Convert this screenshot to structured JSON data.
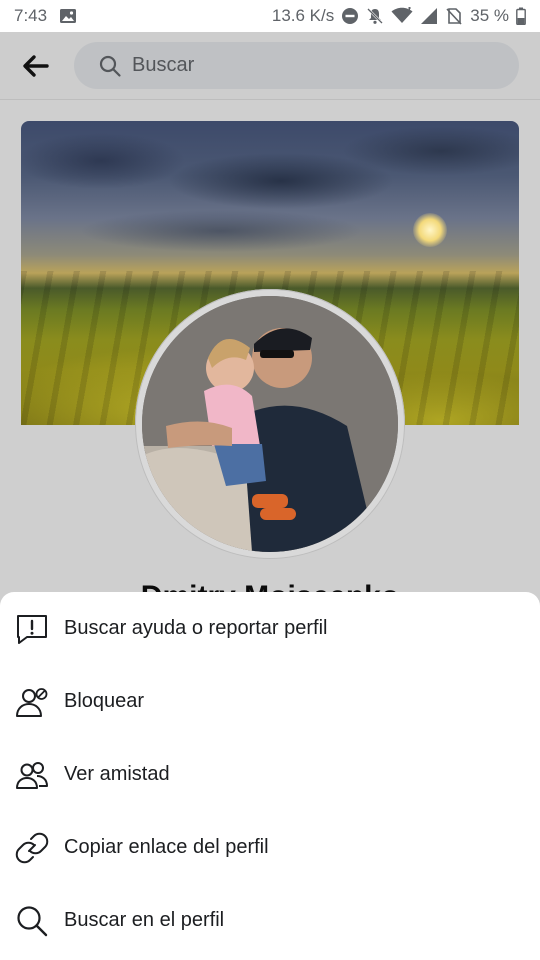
{
  "status_bar": {
    "time": "7:43",
    "network_speed": "13.6 K/s",
    "battery": "35 %",
    "icons": [
      "image-notification-icon",
      "data-saver-icon",
      "mute-icon",
      "wifi-icon",
      "signal-icon",
      "no-sim-icon",
      "battery-icon"
    ]
  },
  "header": {
    "back_icon": "arrow-left-icon",
    "search_placeholder": "Buscar"
  },
  "profile": {
    "name": "Dmitry Moiseenko"
  },
  "sheet": {
    "items": [
      {
        "label": "Buscar ayuda o reportar perfil",
        "icon": "report-icon"
      },
      {
        "label": "Bloquear",
        "icon": "block-user-icon"
      },
      {
        "label": "Ver amistad",
        "icon": "friends-icon"
      },
      {
        "label": "Copiar enlace del perfil",
        "icon": "link-icon"
      },
      {
        "label": "Buscar en el perfil",
        "icon": "search-icon"
      }
    ]
  },
  "colors": {
    "sheet_background": "#ffffff",
    "dim_overlay": "#cfcfcf",
    "text_primary": "#1c1e21"
  }
}
